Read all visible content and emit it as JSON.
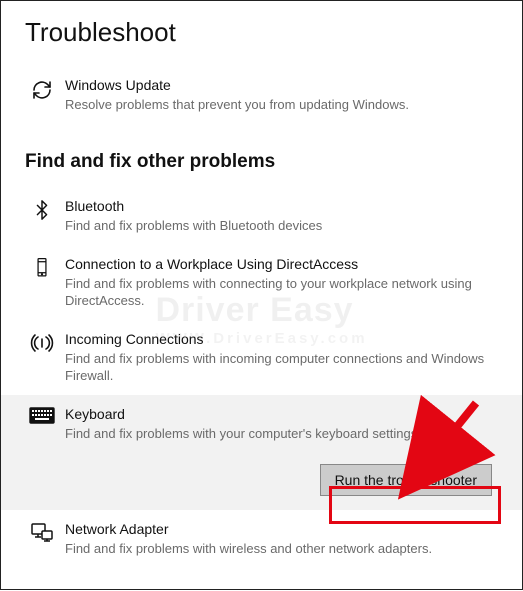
{
  "page": {
    "title": "Troubleshoot"
  },
  "top_item": {
    "title": "Windows Update",
    "desc": "Resolve problems that prevent you from updating Windows."
  },
  "section": {
    "heading": "Find and fix other problems"
  },
  "items": [
    {
      "title": "Bluetooth",
      "desc": "Find and fix problems with Bluetooth devices"
    },
    {
      "title": "Connection to a Workplace Using DirectAccess",
      "desc": "Find and fix problems with connecting to your workplace network using DirectAccess."
    },
    {
      "title": "Incoming Connections",
      "desc": "Find and fix problems with incoming computer connections and Windows Firewall."
    },
    {
      "title": "Keyboard",
      "desc": "Find and fix problems with your computer's keyboard settings."
    },
    {
      "title": "Network Adapter",
      "desc": "Find and fix problems with wireless and other network adapters."
    }
  ],
  "button": {
    "run": "Run the troubleshooter"
  },
  "watermark": {
    "main": "Driver Easy",
    "sub": "WWW.DriverEasy.com"
  }
}
